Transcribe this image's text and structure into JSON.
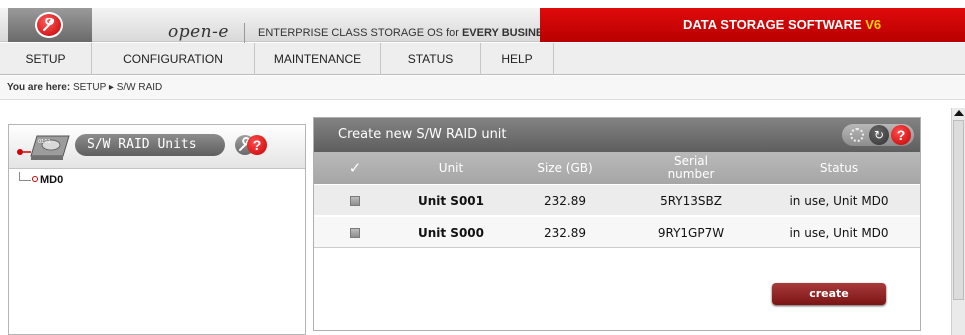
{
  "header": {
    "brand": "open-e",
    "tagline_prefix": "ENTERPRISE CLASS STORAGE OS for ",
    "tagline_bold": "EVERY BUSINESS",
    "banner_text": "DATA STORAGE SOFTWARE ",
    "banner_version": "V6",
    "colors": {
      "banner": "#c80000",
      "version": "#ffd400"
    }
  },
  "menu": {
    "items": [
      {
        "label": "SETUP"
      },
      {
        "label": "CONFIGURATION"
      },
      {
        "label": "MAINTENANCE"
      },
      {
        "label": "STATUS"
      },
      {
        "label": "HELP"
      }
    ]
  },
  "breadcrumb": {
    "prefix": "You are here:",
    "path": "SETUP ▸ S/W RAID"
  },
  "left_panel": {
    "tab_label": "S/W RAID Units",
    "help_glyph": "?",
    "tree": [
      {
        "label": "MD0"
      }
    ],
    "icons": [
      "hard-drive-icon",
      "wrench-icon",
      "help-icon"
    ]
  },
  "right_panel": {
    "title": "Create new S/W RAID unit",
    "icons": [
      "dotted-circle-icon",
      "refresh-icon",
      "help-icon"
    ],
    "refresh_glyph": "↻",
    "help_glyph": "?",
    "table": {
      "headers": {
        "check": "✓",
        "unit": "Unit",
        "size": "Size (GB)",
        "serial_line1": "Serial",
        "serial_line2": "number",
        "status": "Status"
      },
      "rows": [
        {
          "unit": "Unit S001",
          "size": "232.89",
          "serial": "5RY13SBZ",
          "status": "in use, Unit MD0"
        },
        {
          "unit": "Unit S000",
          "size": "232.89",
          "serial": "9RY1GP7W",
          "status": "in use, Unit MD0"
        }
      ]
    },
    "create_label": "create"
  }
}
